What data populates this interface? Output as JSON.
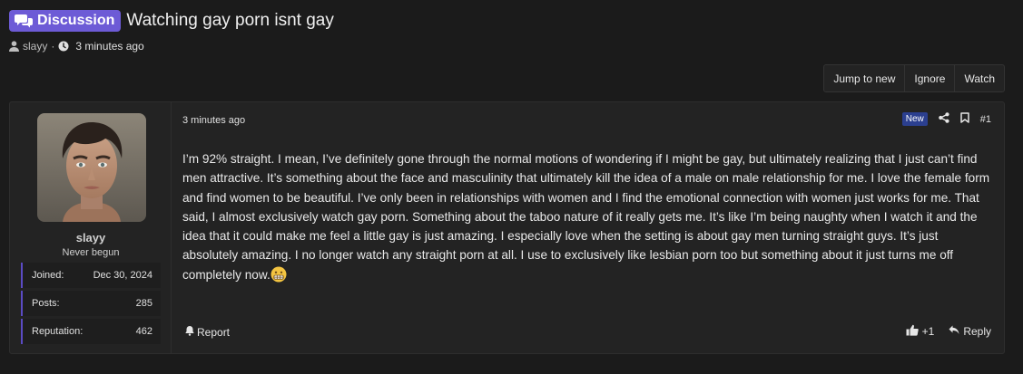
{
  "thread": {
    "prefix": "Discussion",
    "title": "Watching gay porn isnt gay",
    "author": "slayy",
    "separator": "·",
    "time": "3 minutes ago"
  },
  "actions": [
    "Jump to new",
    "Ignore",
    "Watch"
  ],
  "user": {
    "name": "slayy",
    "title": "Never begun",
    "stats": [
      {
        "label": "Joined:",
        "value": "Dec 30, 2024"
      },
      {
        "label": "Posts:",
        "value": "285"
      },
      {
        "label": "Reputation:",
        "value": "462"
      }
    ]
  },
  "post": {
    "time": "3 minutes ago",
    "badge": "New",
    "number": "#1",
    "body": "I’m 92% straight. I mean, I’ve definitely gone through the normal motions of wondering if I might be gay, but ultimately realizing that I just can’t find men attractive. It’s something about the face and masculinity that ultimately kill the idea of a male on male relationship for me. I love the female form and find women to be beautiful. I’ve only been in relationships with women and I find the emotional connection with women just works for me. That said, I almost exclusively watch gay porn. Something about the taboo nature of it really gets me. It’s like I’m being naughty when I watch it and the idea that it could make me feel a little gay is just amazing. I especially love when the setting is about gay men turning straight guys. It’s just absolutely amazing. I no longer watch any straight porn at all. I use to exclusively like lesbian porn too but something about it just turns me off completely now.",
    "report_label": "Report",
    "reaction_count": "+1",
    "reply_label": "Reply"
  },
  "icons": {
    "prefix": "chat-bubbles-icon",
    "author": "user-icon",
    "time": "clock-icon",
    "share": "share-icon",
    "bookmark": "bookmark-icon",
    "report": "bell-icon",
    "reaction": "thumbs-up-icon",
    "reply": "reply-icon",
    "emoji": "grimacing-face-icon"
  },
  "colors": {
    "accent": "#6d5bd6",
    "new_badge": "#2b3f8f",
    "background": "#1b1b1b",
    "panel": "#232323"
  }
}
